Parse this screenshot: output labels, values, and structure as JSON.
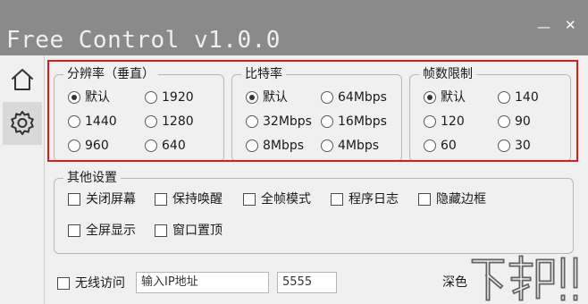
{
  "window": {
    "title": "Free Control v1.0.0",
    "minimize_glyph": "—",
    "close_glyph": "✕"
  },
  "sidebar": {
    "items": [
      {
        "icon": "home-icon"
      },
      {
        "icon": "gear-icon",
        "active": true
      }
    ]
  },
  "resolution": {
    "title": "分辨率（垂直）",
    "options": [
      "默认",
      "1920",
      "1440",
      "1280",
      "960",
      "640"
    ],
    "selected": "默认"
  },
  "bitrate": {
    "title": "比特率",
    "options": [
      "默认",
      "64Mbps",
      "32Mbps",
      "16Mbps",
      "8Mbps",
      "4Mbps"
    ],
    "selected": "默认"
  },
  "framerate": {
    "title": "帧数限制",
    "options": [
      "默认",
      "140",
      "120",
      "90",
      "60",
      "30"
    ],
    "selected": "默认"
  },
  "other": {
    "title": "其他设置",
    "options": [
      "关闭屏幕",
      "保持唤醒",
      "全帧模式",
      "程序日志",
      "隐藏边框",
      "全屏显示",
      "窗口置顶"
    ]
  },
  "wireless": {
    "label": "无线访问",
    "ip_placeholder": "输入IP地址",
    "port_value": "5555"
  },
  "theme": {
    "label": "深色"
  },
  "colors": {
    "titlebar": "#8a8a8a",
    "highlight": "#e11b1b"
  }
}
